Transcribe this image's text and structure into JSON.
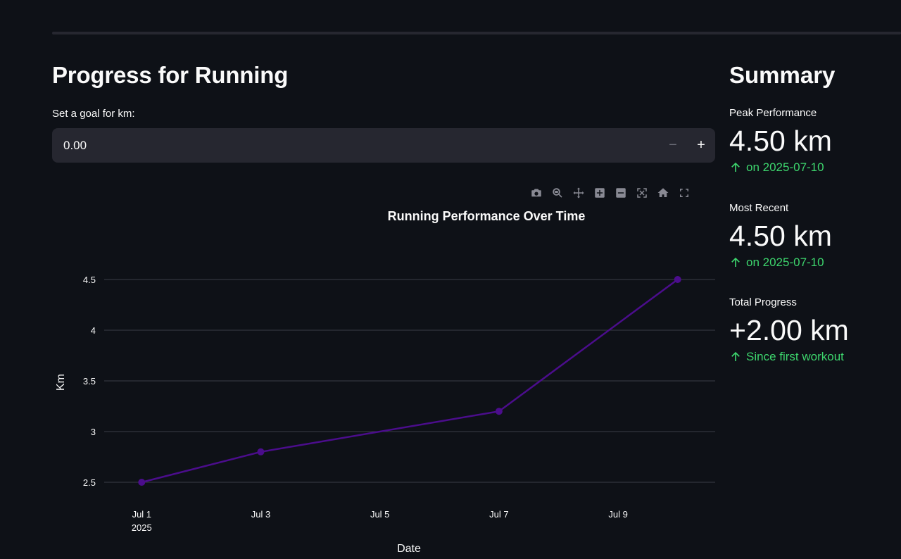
{
  "main": {
    "title": "Progress for Running",
    "goal": {
      "label": "Set a goal for km:",
      "value": "0.00",
      "minus_label": "−",
      "plus_label": "+"
    }
  },
  "modebar": {
    "icons": [
      "camera-icon",
      "zoom-icon",
      "pan-icon",
      "zoom-in-icon",
      "zoom-out-icon",
      "autoscale-icon",
      "home-icon",
      "fullscreen-icon"
    ]
  },
  "summary": {
    "title": "Summary",
    "metrics": [
      {
        "label": "Peak Performance",
        "value": "4.50 km",
        "delta": "on 2025-07-10"
      },
      {
        "label": "Most Recent",
        "value": "4.50 km",
        "delta": "on 2025-07-10"
      },
      {
        "label": "Total Progress",
        "value": "+2.00 km",
        "delta": "Since first workout"
      }
    ]
  },
  "colors": {
    "background": "#0e1117",
    "line": "#4b0d8c",
    "delta_positive": "#3dd56d"
  },
  "chart_data": {
    "type": "line",
    "title": "Running Performance Over Time",
    "xlabel": "Date",
    "ylabel": "Km",
    "x": [
      "2025-07-01",
      "2025-07-03",
      "2025-07-07",
      "2025-07-10"
    ],
    "values": [
      2.5,
      2.8,
      3.2,
      4.5
    ],
    "xlim": [
      "2025-07-01",
      "2025-07-10"
    ],
    "ylim": [
      2.5,
      4.5
    ],
    "x_ticks": [
      "Jul 1",
      "Jul 3",
      "Jul 5",
      "Jul 7",
      "Jul 9"
    ],
    "x_tick_dates": [
      "2025-07-01",
      "2025-07-03",
      "2025-07-05",
      "2025-07-07",
      "2025-07-09"
    ],
    "x_tick_year": "2025",
    "y_ticks": [
      2.5,
      3,
      3.5,
      4,
      4.5
    ],
    "y_tick_labels": [
      "2.5",
      "3",
      "3.5",
      "4",
      "4.5"
    ],
    "grid": true
  }
}
